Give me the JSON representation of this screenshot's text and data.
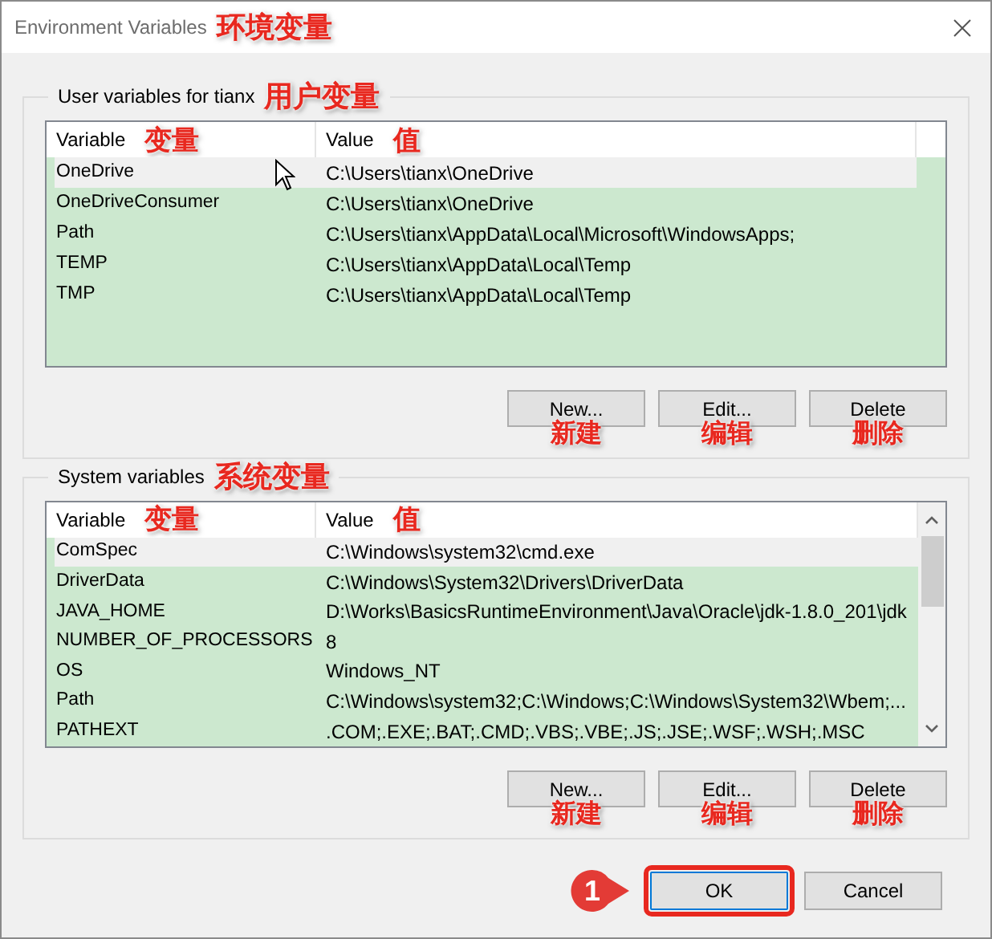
{
  "window": {
    "title": "Environment Variables",
    "annotation": "环境变量"
  },
  "sections": [
    {
      "title": "User variables for tianx",
      "annotation": "用户变量",
      "scrollable": false,
      "columns": [
        {
          "label": "Variable",
          "annotation": "变量"
        },
        {
          "label": "Value",
          "annotation": "值"
        }
      ],
      "rows": [
        {
          "variable": "OneDrive",
          "value": "C:\\Users\\tianx\\OneDrive",
          "highlighted": true
        },
        {
          "variable": "OneDriveConsumer",
          "value": "C:\\Users\\tianx\\OneDrive",
          "highlighted": false
        },
        {
          "variable": "Path",
          "value": "C:\\Users\\tianx\\AppData\\Local\\Microsoft\\WindowsApps;",
          "highlighted": false
        },
        {
          "variable": "TEMP",
          "value": "C:\\Users\\tianx\\AppData\\Local\\Temp",
          "highlighted": false
        },
        {
          "variable": "TMP",
          "value": "C:\\Users\\tianx\\AppData\\Local\\Temp",
          "highlighted": false
        }
      ],
      "buttons": [
        {
          "label": "New...",
          "annotation": "新建"
        },
        {
          "label": "Edit...",
          "annotation": "编辑"
        },
        {
          "label": "Delete",
          "annotation": "删除"
        }
      ]
    },
    {
      "title": "System variables",
      "annotation": "系统变量",
      "scrollable": true,
      "columns": [
        {
          "label": "Variable",
          "annotation": "变量"
        },
        {
          "label": "Value",
          "annotation": "值"
        }
      ],
      "rows": [
        {
          "variable": "ComSpec",
          "value": "C:\\Windows\\system32\\cmd.exe",
          "highlighted": true
        },
        {
          "variable": "DriverData",
          "value": "C:\\Windows\\System32\\Drivers\\DriverData",
          "highlighted": false
        },
        {
          "variable": "JAVA_HOME",
          "value": "D:\\Works\\BasicsRuntimeEnvironment\\Java\\Oracle\\jdk-1.8.0_201\\jdk",
          "highlighted": false
        },
        {
          "variable": "NUMBER_OF_PROCESSORS",
          "value": "8",
          "highlighted": false
        },
        {
          "variable": "OS",
          "value": "Windows_NT",
          "highlighted": false
        },
        {
          "variable": "Path",
          "value": "C:\\Windows\\system32;C:\\Windows;C:\\Windows\\System32\\Wbem;...",
          "highlighted": false
        },
        {
          "variable": "PATHEXT",
          "value": ".COM;.EXE;.BAT;.CMD;.VBS;.VBE;.JS;.JSE;.WSF;.WSH;.MSC",
          "highlighted": false
        }
      ],
      "buttons": [
        {
          "label": "New...",
          "annotation": "新建"
        },
        {
          "label": "Edit...",
          "annotation": "编辑"
        },
        {
          "label": "Delete",
          "annotation": "删除"
        }
      ]
    }
  ],
  "footer": {
    "step": "1",
    "buttons": [
      {
        "label": "OK",
        "highlighted": true
      },
      {
        "label": "Cancel",
        "highlighted": false
      }
    ]
  }
}
